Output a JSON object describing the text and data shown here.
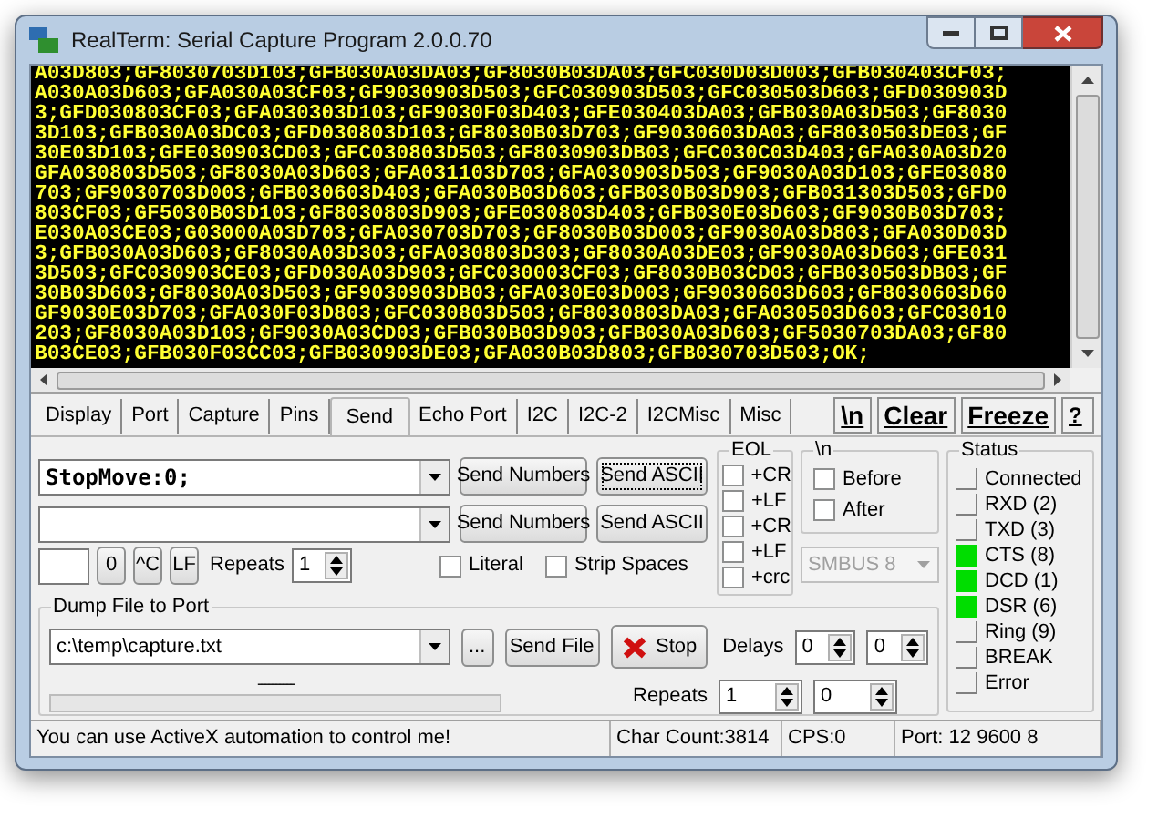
{
  "window": {
    "title": "RealTerm: Serial Capture Program 2.0.0.70"
  },
  "terminal": {
    "lines": [
      "A03D803;GF8030703D103;GFB030A03DA03;GF8030B03DA03;GFC030D03D003;GFB030403CF03;",
      "A030A03D603;GFA030A03CF03;GF9030903D503;GFC030903D503;GFC030503D603;GFD030903D",
      "3;GFD030803CF03;GFA030303D103;GF9030F03D403;GFE030403DA03;GFB030A03D503;GF8030",
      "3D103;GFB030A03DC03;GFD030803D103;GF8030B03D703;GF9030603DA03;GF8030503DE03;GF",
      "30E03D103;GFE030903CD03;GFC030803D503;GF8030903DB03;GFC030C03D403;GFA030A03D20",
      "GFA030803D503;GF8030A03D603;GFA031103D703;GFA030903D503;GF9030A03D103;GFE03080",
      "703;GF9030703D003;GFB030603D403;GFA030B03D603;GFB030B03D903;GFB031303D503;GFD0",
      "803CF03;GF5030B03D103;GF8030803D903;GFE030803D403;GFB030E03D603;GF9030B03D703;",
      "E030A03CE03;G03000A03D703;GFA030703D703;GF8030B03D003;GF9030A03D803;GFA030D03D",
      "3;GFB030A03D603;GF8030A03D303;GFA030803D303;GF8030A03DE03;GF9030A03D603;GFE031",
      "3D503;GFC030903CE03;GFD030A03D903;GFC030003CF03;GF8030B03CD03;GFB030503DB03;GF",
      "30B03D603;GF8030A03D503;GF9030903DB03;GFA030E03D003;GF9030603D603;GF8030603D60",
      "GF9030E03D703;GFA030F03D803;GFC030803D503;GF8030803DA03;GFA030503D603;GFC03010",
      "203;GF8030A03D103;GF9030A03CD03;GFB030B03D903;GFB030A03D603;GF5030703DA03;GF80",
      "B03CE03;GFB030F03CC03;GFB030903DE03;GFA030B03D803;GFB030703D503;OK;"
    ]
  },
  "tabs": [
    {
      "label": "Display",
      "selected": false
    },
    {
      "label": "Port",
      "selected": false
    },
    {
      "label": "Capture",
      "selected": false
    },
    {
      "label": "Pins",
      "selected": false
    },
    {
      "label": "Send",
      "selected": true
    },
    {
      "label": "Echo Port",
      "selected": false
    },
    {
      "label": "I2C",
      "selected": false
    },
    {
      "label": "I2C-2",
      "selected": false
    },
    {
      "label": "I2CMisc",
      "selected": false
    },
    {
      "label": "Misc",
      "selected": false
    }
  ],
  "toolbar_buttons": [
    "\\n",
    "Clear",
    "Freeze",
    "?"
  ],
  "send": {
    "rows": [
      {
        "value": "StopMove:0;",
        "buttons": [
          "Send Numbers",
          "Send ASCII"
        ]
      },
      {
        "buttons": [
          "Send Numbers",
          "Send ASCII"
        ]
      }
    ],
    "extra_buttons": [
      "0",
      "^C",
      "LF"
    ],
    "repeats_label": "Repeats",
    "repeats": "1",
    "options": [
      {
        "label": "Literal",
        "checked": false
      },
      {
        "label": "Strip Spaces",
        "checked": false
      }
    ]
  },
  "eol": {
    "title": "EOL",
    "options": [
      {
        "label": "+CR",
        "checked": false
      },
      {
        "label": "+LF",
        "checked": false
      },
      {
        "label": "+CR",
        "checked": false
      },
      {
        "label": "+LF",
        "checked": false
      },
      {
        "label": "+crc",
        "checked": false
      }
    ]
  },
  "newline": {
    "title": "\\n",
    "options": [
      {
        "label": "Before",
        "checked": false
      },
      {
        "label": "After",
        "checked": false
      }
    ]
  },
  "smbus": {
    "value": "SMBUS 8",
    "disabled": true
  },
  "dump": {
    "title": "Dump File to Port",
    "file": "c:\\temp\\capture.txt",
    "browse": "...",
    "send_file": "Send File",
    "stop": "Stop",
    "delays_label": "Delays",
    "delays": [
      "0",
      "0"
    ],
    "progress_text": "----------",
    "progress": {
      "level": 0
    },
    "repeats_label": "Repeats",
    "repeats": [
      "1",
      "0"
    ]
  },
  "status": {
    "title": "Status",
    "indicators": [
      {
        "label": "Connected",
        "on": false
      },
      {
        "label": "RXD (2)",
        "on": false
      },
      {
        "label": "TXD (3)",
        "on": false
      },
      {
        "label": "CTS (8)",
        "on": true
      },
      {
        "label": "DCD (1)",
        "on": true
      },
      {
        "label": "DSR (6)",
        "on": true
      },
      {
        "label": "Ring (9)",
        "on": false
      },
      {
        "label": "BREAK",
        "on": false
      },
      {
        "label": "Error",
        "on": false
      }
    ]
  },
  "status_bar": [
    "You can use ActiveX automation to control me!",
    "Char Count:3814",
    "CPS:0",
    "Port: 12 9600 8"
  ]
}
